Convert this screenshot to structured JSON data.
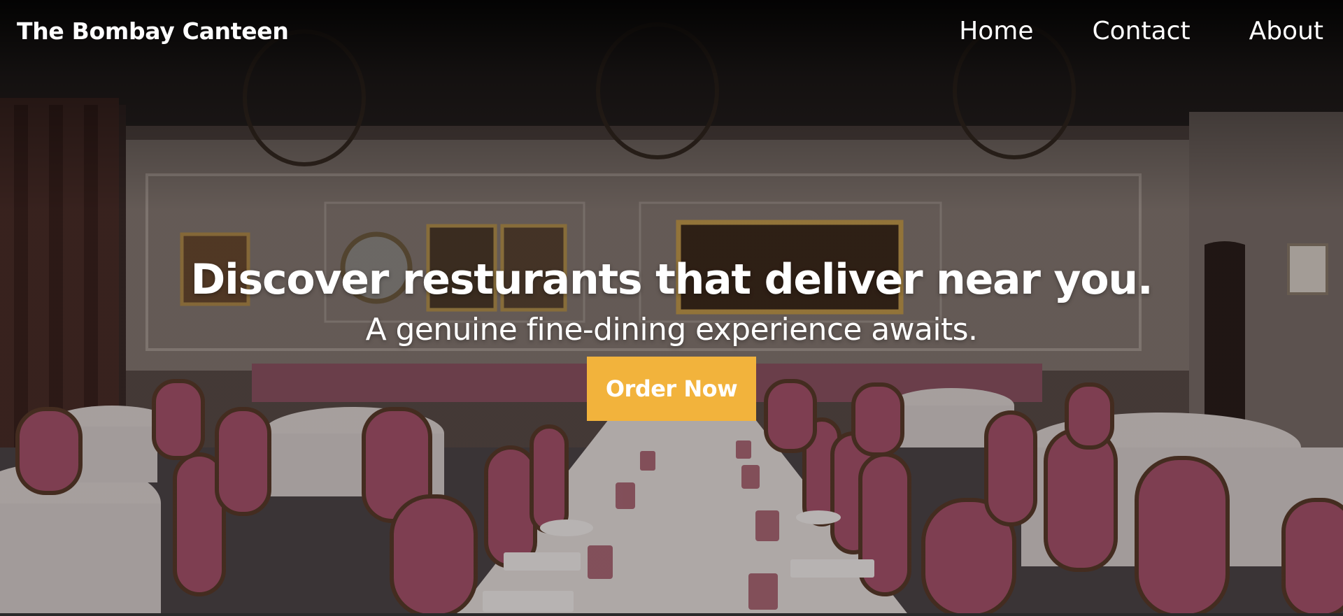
{
  "navbar": {
    "brand": "The Bombay Canteen",
    "links": [
      {
        "label": "Home"
      },
      {
        "label": "Contact"
      },
      {
        "label": "About"
      }
    ]
  },
  "hero": {
    "title": "Discover resturants that deliver near you.",
    "subtitle": "A genuine fine-dining experience awaits.",
    "cta_label": "Order Now"
  },
  "colors": {
    "cta_background": "#f2b33c",
    "text": "#ffffff"
  }
}
